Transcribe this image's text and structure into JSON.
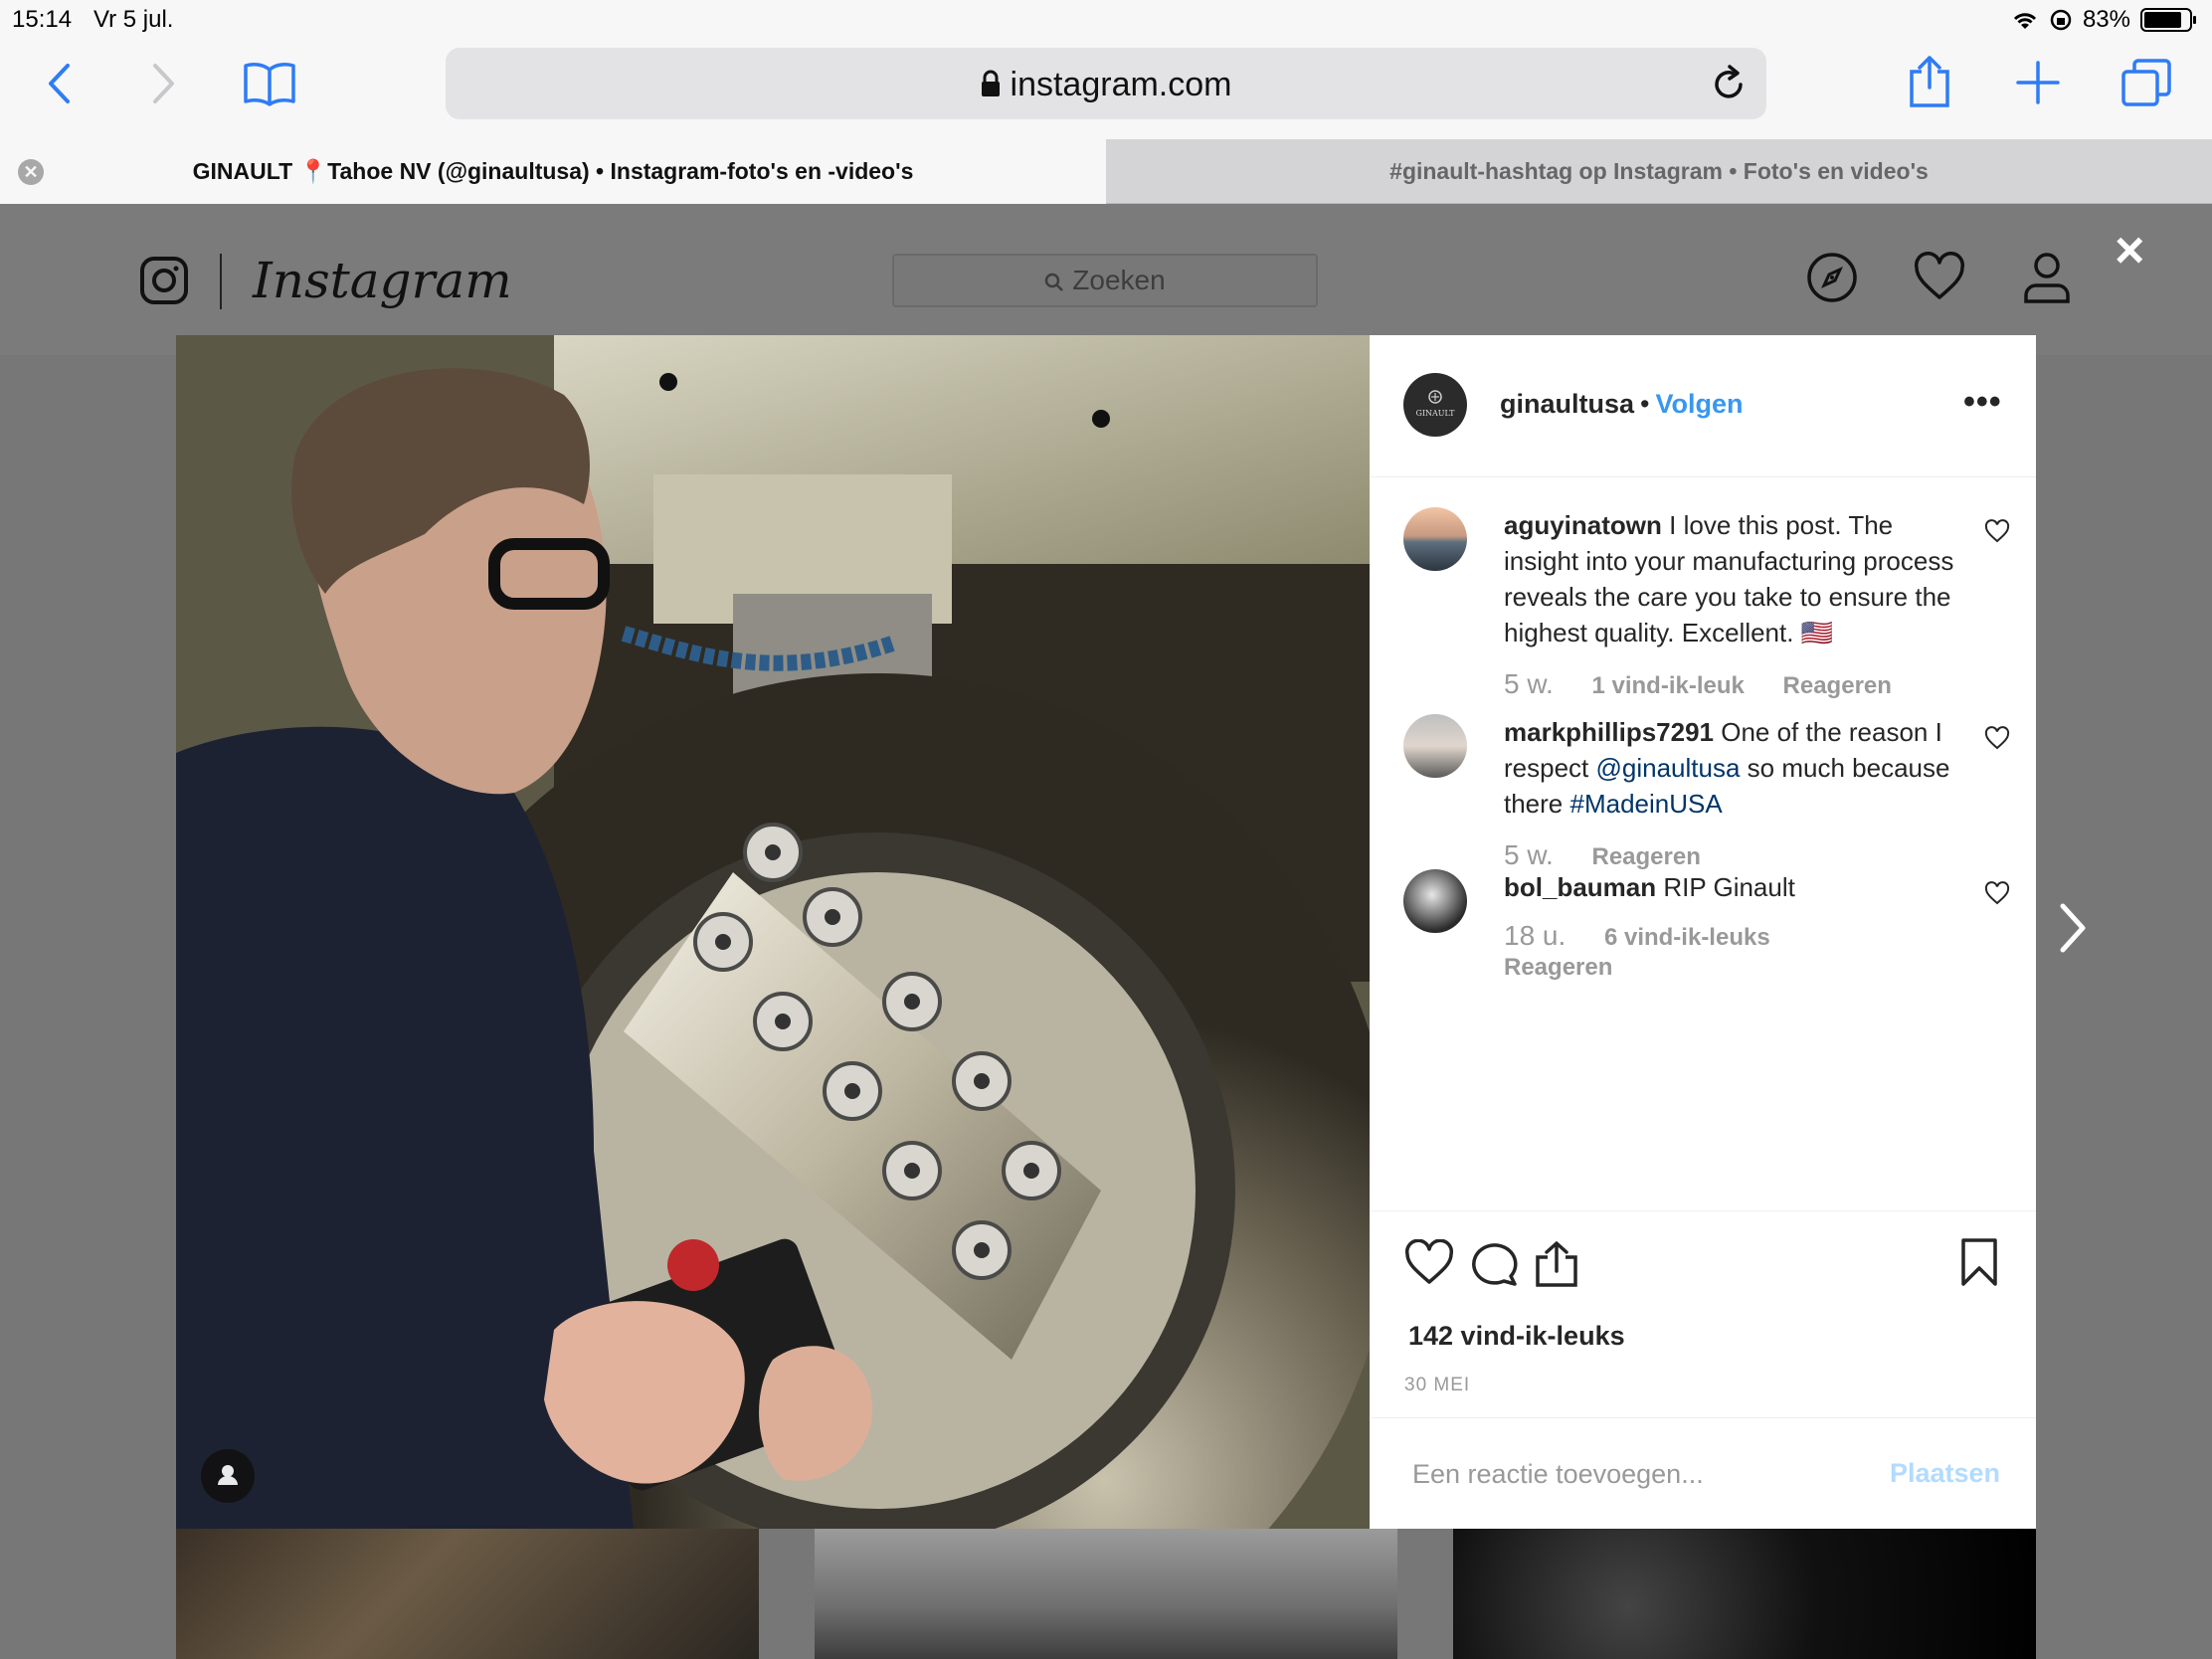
{
  "status": {
    "time": "15:14",
    "date": "Vr 5 jul.",
    "battery": "83%",
    "battery_level": 0.83
  },
  "browser": {
    "url": "instagram.com"
  },
  "tabs": [
    {
      "title": "GINAULT 📍Tahoe NV (@ginaultusa) • Instagram-foto's en -video's"
    },
    {
      "title": "#ginault-hashtag op Instagram • Foto's en video's"
    }
  ],
  "instagram": {
    "wordmark": "Instagram",
    "search_placeholder": "Zoeken",
    "close_glyph": "×"
  },
  "post": {
    "author": "ginaultusa",
    "author_avatar_text": "GINAULT",
    "follow_label": "Volgen",
    "more_glyph": "•••",
    "likes": "142 vind-ik-leuks",
    "date": "30 MEI",
    "comment_placeholder": "Een reactie toevoegen...",
    "post_label": "Plaatsen"
  },
  "comments": [
    {
      "user": "aguyinatown",
      "text": "I love this post. The insight into your manufacturing process reveals the care you take to ensure the highest quality. Excellent. 🇺🇸",
      "time": "5 w.",
      "likes": "1 vind-ik-leuk",
      "reply": "Reageren"
    },
    {
      "user": "markphillips7291",
      "text_before": "One of the reason I respect",
      "mention": "@ginaultusa",
      "text_middle": "so much because there",
      "hashtag": "#MadeinUSA",
      "time": "5 w.",
      "reply": "Reageren"
    },
    {
      "user": "bol_bauman",
      "text": "RIP Ginault",
      "time": "18 u.",
      "likes": "6 vind-ik-leuks",
      "reply": "Reageren"
    }
  ],
  "icons": {
    "toolbar": [
      "back-icon",
      "forward-icon",
      "bookmarks-icon",
      "share-icon",
      "new-tab-icon",
      "tabs-icon"
    ],
    "ig_nav": [
      "explore-icon",
      "activity-heart-icon",
      "profile-icon"
    ],
    "post_actions": [
      "like-icon",
      "comment-icon",
      "share-icon",
      "save-icon"
    ]
  },
  "colors": {
    "link_blue": "#3897f0",
    "mention_blue": "#003569",
    "safari_blue": "#2e7cf6"
  }
}
